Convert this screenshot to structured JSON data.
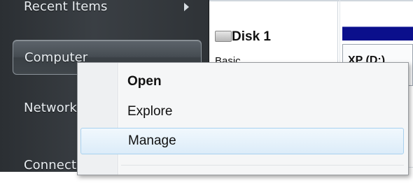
{
  "start_menu": {
    "items": [
      {
        "label": "Recent Items",
        "has_submenu": true
      },
      {
        "label": "Computer",
        "highlighted": true
      },
      {
        "label": "Network"
      },
      {
        "label": "Connect To"
      }
    ]
  },
  "background_window": {
    "disk_label": "Disk 1",
    "disk_subtitle": "Basic",
    "volume_label": "XP (D:)"
  },
  "context_menu": {
    "items": [
      {
        "label": "Open",
        "default": true
      },
      {
        "label": "Explore"
      },
      {
        "label": "Manage",
        "hovered": true
      }
    ]
  },
  "colors": {
    "start_menu_bg": "#3a3f44",
    "hover_highlight": "#dcecf9",
    "volume_bar": "#0b0f8c"
  }
}
